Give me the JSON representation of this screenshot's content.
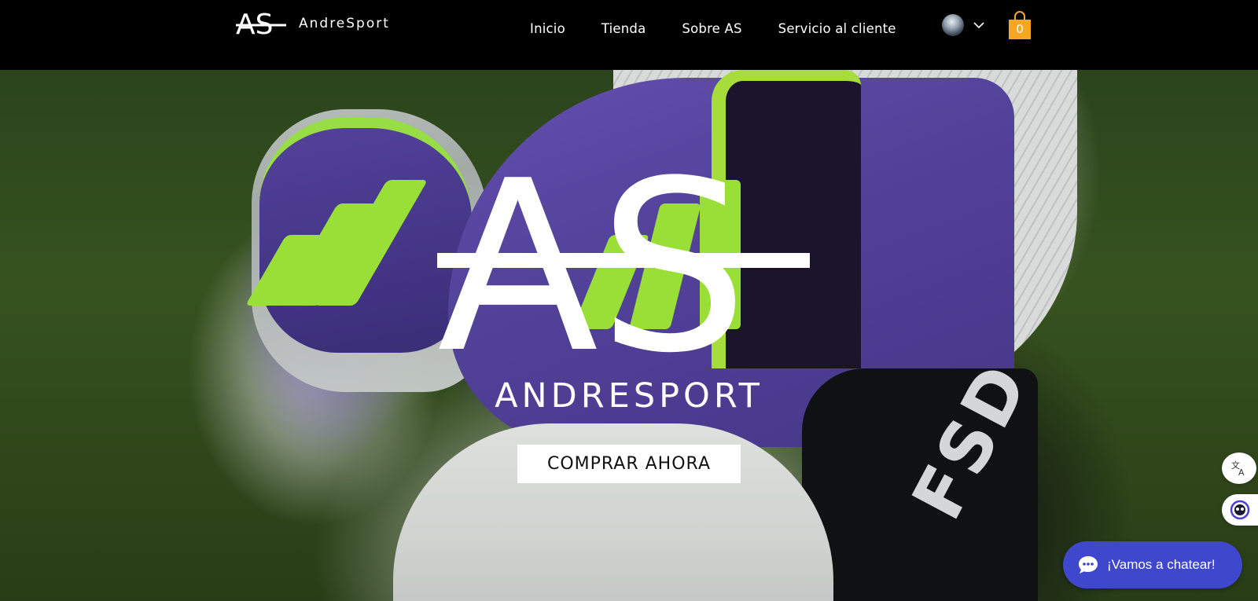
{
  "header": {
    "brand_name": "AndreSport",
    "logo_mark": "AS",
    "nav": [
      {
        "label": "Inicio"
      },
      {
        "label": "Tienda"
      },
      {
        "label": "Sobre AS"
      },
      {
        "label": "Servicio al cliente"
      }
    ],
    "cart_count": "0"
  },
  "hero": {
    "logo_mark": "AS",
    "title": "ANDRESPORT",
    "cta_label": "COMPRAR AHORA",
    "image_text": "FSD"
  },
  "widgets": {
    "chat_label": "¡Vamos a chatear!"
  },
  "colors": {
    "header_bg": "#000000",
    "cart_orange": "#F5A623",
    "chat_blue": "#3F48CC",
    "accent_green": "#A8F23C",
    "accent_purple": "#5947A6"
  },
  "icons": [
    "avatar",
    "chevron-down-icon",
    "cart-icon",
    "translate-icon",
    "bot-icon",
    "chat-bubble-icon"
  ]
}
